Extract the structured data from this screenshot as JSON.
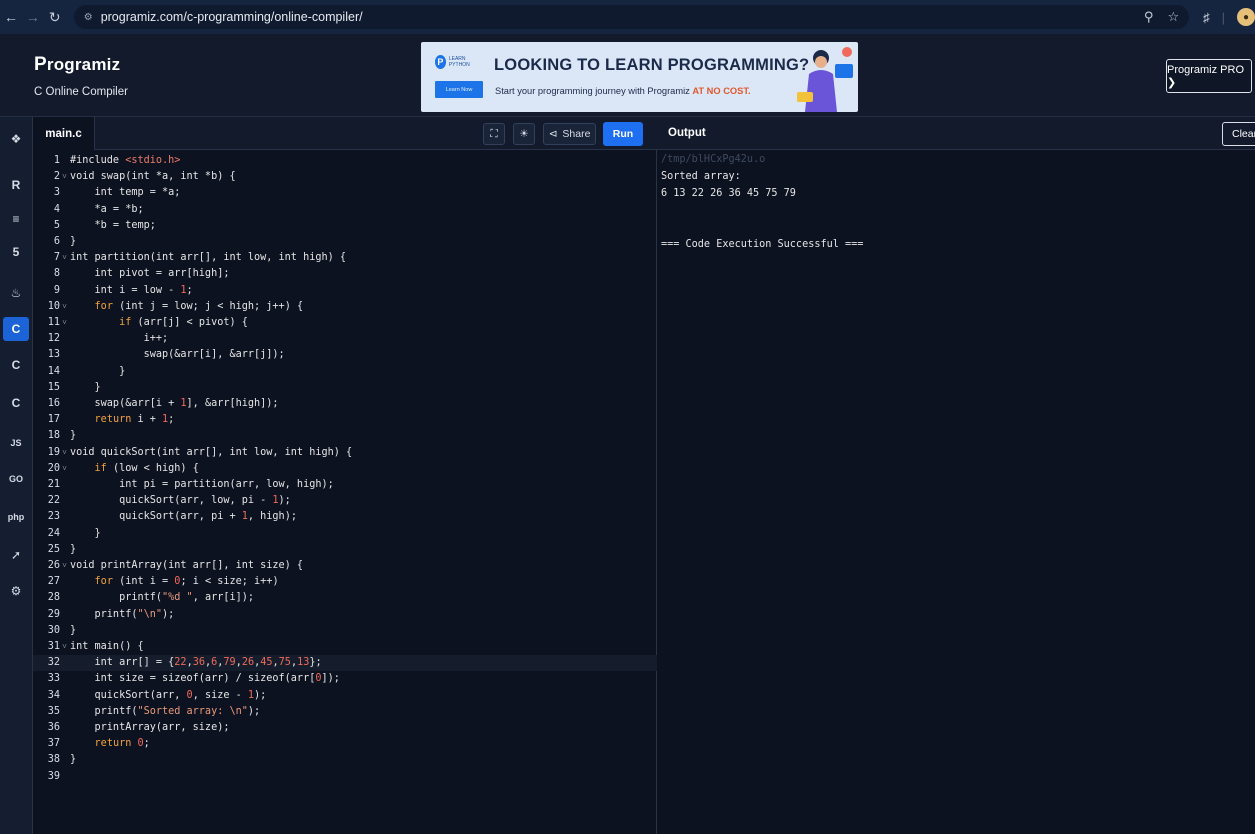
{
  "browser": {
    "url": "programiz.com/c-programming/online-compiler/",
    "colors": {
      "frame": "#16253f",
      "url_bg": "#0f1a2e"
    }
  },
  "header": {
    "logo_initial": "P",
    "logo_rest": "rogramiz",
    "subtitle": "C Online Compiler",
    "pro_button": "Programiz PRO ❯"
  },
  "banner": {
    "headline": "LOOKING TO LEARN PROGRAMMING?",
    "sub_prefix": "Start your programming journey with Programiz ",
    "sub_highlight": "AT NO COST.",
    "mini_logo_text": "LEARN PYTHON",
    "mini_button": "Learn Now"
  },
  "sidebar": {
    "items": [
      {
        "icon": "python-icon",
        "glyph": "❖"
      },
      {
        "icon": "r-icon",
        "glyph": "R"
      },
      {
        "icon": "database-icon",
        "glyph": "≡"
      },
      {
        "icon": "html-icon",
        "glyph": "5"
      },
      {
        "icon": "java-icon",
        "glyph": "♨"
      },
      {
        "icon": "c-icon",
        "glyph": "C",
        "active": true
      },
      {
        "icon": "cpp-icon",
        "glyph": "C"
      },
      {
        "icon": "csharp-icon",
        "glyph": "C"
      },
      {
        "icon": "javascript-icon",
        "glyph": "JS"
      },
      {
        "icon": "go-icon",
        "glyph": "GO"
      },
      {
        "icon": "php-icon",
        "glyph": "php"
      },
      {
        "icon": "swift-icon",
        "glyph": "➚"
      },
      {
        "icon": "rust-icon",
        "glyph": "⚙"
      }
    ]
  },
  "editor": {
    "file_tab": "main.c",
    "share_label": "Share",
    "run_label": "Run",
    "lines": [
      "#include <stdio.h>",
      "void swap(int *a, int *b) {",
      "    int temp = *a;",
      "    *a = *b;",
      "    *b = temp;",
      "}",
      "int partition(int arr[], int low, int high) {",
      "    int pivot = arr[high];",
      "    int i = low - 1;",
      "    for (int j = low; j < high; j++) {",
      "        if (arr[j] < pivot) {",
      "            i++;",
      "            swap(&arr[i], &arr[j]);",
      "        }",
      "    }",
      "    swap(&arr[i + 1], &arr[high]);",
      "    return i + 1;",
      "}",
      "void quickSort(int arr[], int low, int high) {",
      "    if (low < high) {",
      "        int pi = partition(arr, low, high);",
      "        quickSort(arr, low, pi - 1);",
      "        quickSort(arr, pi + 1, high);",
      "    }",
      "}",
      "void printArray(int arr[], int size) {",
      "    for (int i = 0; i < size; i++)",
      "        printf(\"%d \", arr[i]);",
      "    printf(\"\\n\");",
      "}",
      "int main() {",
      "    int arr[] = {22,36,6,79,26,45,75,13};",
      "    int size = sizeof(arr) / sizeof(arr[0]);",
      "    quickSort(arr, 0, size - 1);",
      "    printf(\"Sorted array: \\n\");",
      "    printArray(arr, size);",
      "    return 0;",
      "}",
      ""
    ],
    "fold_lines": [
      2,
      7,
      10,
      11,
      19,
      20,
      26,
      31
    ],
    "current_line": 32
  },
  "output": {
    "title": "Output",
    "clear_label": "Clear",
    "path": "/tmp/blHCxPg42u.o",
    "lines": [
      "Sorted array:",
      "6 13 22 26 36 45 75 79",
      "",
      "",
      "=== Code Execution Successful ==="
    ]
  }
}
